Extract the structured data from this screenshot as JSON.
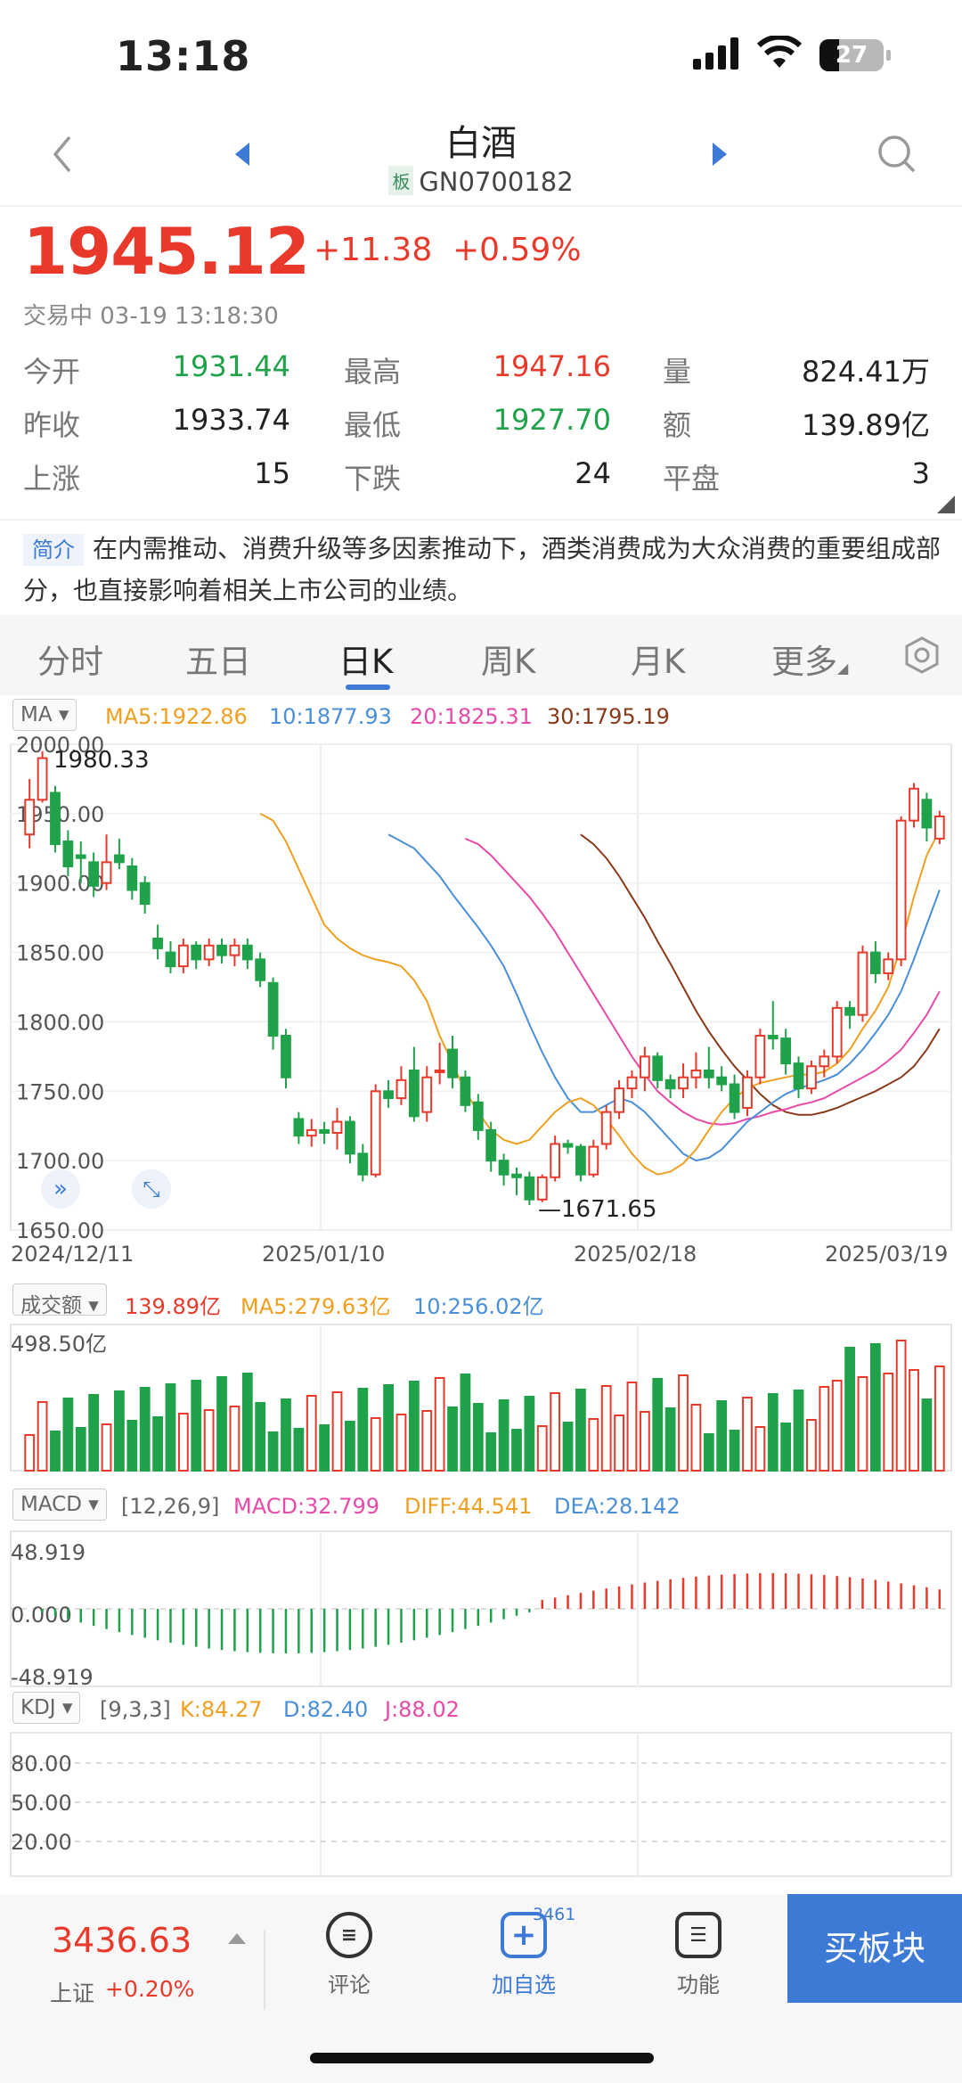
{
  "status_bar": {
    "time": "13:18",
    "battery": "27"
  },
  "header": {
    "title": "白酒",
    "board_tag": "板",
    "code": "GN0700182"
  },
  "quote": {
    "price": "1945.12",
    "change": "+11.38",
    "change_pct": "+0.59%",
    "status_time": "交易中 03-19 13:18:30"
  },
  "stats": [
    {
      "label": "今开",
      "value": "1931.44",
      "color": "green"
    },
    {
      "label": "最高",
      "value": "1947.16",
      "color": "red"
    },
    {
      "label": "量",
      "value": "824.41万",
      "color": "dark"
    },
    {
      "label": "昨收",
      "value": "1933.74",
      "color": "dark"
    },
    {
      "label": "最低",
      "value": "1927.70",
      "color": "green"
    },
    {
      "label": "额",
      "value": "139.89亿",
      "color": "dark"
    },
    {
      "label": "上涨",
      "value": "15",
      "color": "dark"
    },
    {
      "label": "下跌",
      "value": "24",
      "color": "dark"
    },
    {
      "label": "平盘",
      "value": "3",
      "color": "dark"
    }
  ],
  "intro": {
    "tag": "简介",
    "text": "在内需推动、消费升级等多因素推动下，酒类消费成为大众消费的重要组成部分，也直接影响着相关上市公司的业绩。"
  },
  "tabs": [
    "分时",
    "五日",
    "日K",
    "周K",
    "月K",
    "更多"
  ],
  "active_tab": "日K",
  "colors": {
    "up": "#e8392b",
    "down": "#1fa24a",
    "ma5": "#f0a020",
    "ma10": "#4a8fd8",
    "ma20": "#e84aa8",
    "ma30": "#8a3a1a",
    "accent": "#3c7ad6"
  },
  "ma_legend": {
    "selector": "MA",
    "ma5": "MA5:1922.86",
    "ma10": "10:1877.93",
    "ma20": "20:1825.31",
    "ma30": "30:1795.19"
  },
  "vol_legend": {
    "selector": "成交额",
    "value": "139.89亿",
    "ma5": "MA5:279.63亿",
    "ma10": "10:256.02亿"
  },
  "macd_legend": {
    "selector": "MACD",
    "params": "[12,26,9]",
    "macd": "MACD:32.799",
    "diff": "DIFF:44.541",
    "dea": "DEA:28.142"
  },
  "kdj_legend": {
    "selector": "KDJ",
    "params": "[9,3,3]",
    "k": "K:84.27",
    "d": "D:82.40",
    "j": "J:88.02"
  },
  "chart_data": {
    "type": "candlestick",
    "price_axis": {
      "ticks": [
        "2000.00",
        "1950.00",
        "1900.00",
        "1850.00",
        "1800.00",
        "1750.00",
        "1700.00",
        "1650.00"
      ],
      "ylim": [
        1650,
        2000
      ]
    },
    "dates": [
      "2024/12/11",
      "2025/01/10",
      "2025/02/18",
      "2025/03/19"
    ],
    "max_label": "1980.33",
    "min_label": "1671.65",
    "candles": [
      [
        1935,
        1960,
        1925,
        1975
      ],
      [
        1960,
        1990,
        1958,
        1995
      ],
      [
        1965,
        1928,
        1922,
        1970
      ],
      [
        1930,
        1912,
        1905,
        1938
      ],
      [
        1920,
        1918,
        1900,
        1930
      ],
      [
        1915,
        1898,
        1890,
        1922
      ],
      [
        1900,
        1915,
        1895,
        1935
      ],
      [
        1920,
        1915,
        1910,
        1932
      ],
      [
        1912,
        1895,
        1888,
        1918
      ],
      [
        1900,
        1885,
        1878,
        1905
      ],
      [
        1860,
        1853,
        1845,
        1870
      ],
      [
        1850,
        1840,
        1835,
        1858
      ],
      [
        1840,
        1855,
        1835,
        1860
      ],
      [
        1855,
        1845,
        1838,
        1858
      ],
      [
        1845,
        1855,
        1840,
        1860
      ],
      [
        1855,
        1848,
        1842,
        1860
      ],
      [
        1848,
        1855,
        1840,
        1860
      ],
      [
        1855,
        1845,
        1838,
        1860
      ],
      [
        1845,
        1830,
        1825,
        1850
      ],
      [
        1828,
        1790,
        1780,
        1832
      ],
      [
        1790,
        1760,
        1752,
        1795
      ],
      [
        1730,
        1718,
        1712,
        1735
      ],
      [
        1718,
        1722,
        1710,
        1730
      ],
      [
        1722,
        1720,
        1712,
        1728
      ],
      [
        1720,
        1728,
        1708,
        1738
      ],
      [
        1728,
        1705,
        1698,
        1732
      ],
      [
        1705,
        1690,
        1685,
        1712
      ],
      [
        1690,
        1750,
        1688,
        1755
      ],
      [
        1750,
        1745,
        1738,
        1758
      ],
      [
        1745,
        1758,
        1740,
        1768
      ],
      [
        1765,
        1732,
        1728,
        1782
      ],
      [
        1735,
        1760,
        1728,
        1768
      ],
      [
        1765,
        1765,
        1755,
        1785
      ],
      [
        1780,
        1760,
        1752,
        1790
      ],
      [
        1760,
        1740,
        1735,
        1765
      ],
      [
        1742,
        1722,
        1715,
        1748
      ],
      [
        1722,
        1700,
        1692,
        1728
      ],
      [
        1700,
        1690,
        1682,
        1705
      ],
      [
        1690,
        1688,
        1675,
        1695
      ],
      [
        1688,
        1672,
        1668,
        1692
      ],
      [
        1672,
        1688,
        1670,
        1690
      ],
      [
        1688,
        1712,
        1685,
        1718
      ],
      [
        1712,
        1710,
        1705,
        1715
      ],
      [
        1710,
        1690,
        1685,
        1712
      ],
      [
        1690,
        1710,
        1688,
        1715
      ],
      [
        1712,
        1735,
        1708,
        1740
      ],
      [
        1735,
        1752,
        1730,
        1758
      ],
      [
        1752,
        1760,
        1745,
        1765
      ],
      [
        1760,
        1775,
        1750,
        1782
      ],
      [
        1775,
        1758,
        1752,
        1778
      ],
      [
        1758,
        1752,
        1745,
        1762
      ],
      [
        1752,
        1760,
        1745,
        1770
      ],
      [
        1760,
        1765,
        1752,
        1778
      ],
      [
        1765,
        1760,
        1752,
        1782
      ],
      [
        1760,
        1755,
        1750,
        1768
      ],
      [
        1755,
        1735,
        1730,
        1762
      ],
      [
        1738,
        1760,
        1732,
        1765
      ],
      [
        1760,
        1790,
        1755,
        1795
      ],
      [
        1790,
        1788,
        1780,
        1815
      ],
      [
        1788,
        1770,
        1762,
        1795
      ],
      [
        1770,
        1752,
        1745,
        1775
      ],
      [
        1752,
        1768,
        1748,
        1772
      ],
      [
        1768,
        1775,
        1760,
        1780
      ],
      [
        1775,
        1810,
        1770,
        1815
      ],
      [
        1810,
        1805,
        1795,
        1815
      ],
      [
        1805,
        1850,
        1800,
        1855
      ],
      [
        1850,
        1835,
        1828,
        1858
      ],
      [
        1835,
        1845,
        1830,
        1850
      ],
      [
        1845,
        1945,
        1840,
        1948
      ],
      [
        1945,
        1968,
        1940,
        1972
      ],
      [
        1960,
        1940,
        1930,
        1965
      ],
      [
        1932,
        1948,
        1928,
        1952
      ]
    ],
    "ma": {
      "ma5": [
        1950,
        1945,
        1930,
        1910,
        1890,
        1870,
        1860,
        1853,
        1848,
        1845,
        1843,
        1840,
        1830,
        1815,
        1790,
        1770,
        1750,
        1735,
        1722,
        1715,
        1712,
        1715,
        1725,
        1735,
        1742,
        1745,
        1740,
        1730,
        1718,
        1705,
        1695,
        1690,
        1692,
        1698,
        1708,
        1722,
        1735,
        1745,
        1752,
        1756,
        1758,
        1760,
        1762,
        1762,
        1764,
        1770,
        1780,
        1795,
        1808,
        1825,
        1855,
        1890,
        1920,
        1938
      ],
      "ma10": [
        1935,
        1930,
        1925,
        1915,
        1905,
        1892,
        1880,
        1868,
        1855,
        1840,
        1820,
        1798,
        1778,
        1760,
        1745,
        1735,
        1735,
        1740,
        1745,
        1742,
        1735,
        1725,
        1715,
        1705,
        1700,
        1702,
        1708,
        1718,
        1728,
        1735,
        1742,
        1748,
        1752,
        1755,
        1758,
        1762,
        1770,
        1780,
        1792,
        1805,
        1822,
        1845,
        1870,
        1895
      ],
      "ma20": [
        1932,
        1928,
        1920,
        1910,
        1900,
        1890,
        1878,
        1865,
        1850,
        1835,
        1820,
        1805,
        1790,
        1775,
        1762,
        1750,
        1742,
        1735,
        1730,
        1727,
        1726,
        1727,
        1730,
        1732,
        1735,
        1737,
        1740,
        1742,
        1745,
        1750,
        1755,
        1760,
        1765,
        1772,
        1780,
        1792,
        1805,
        1822
      ],
      "ma30": [
        1935,
        1928,
        1918,
        1905,
        1890,
        1875,
        1858,
        1842,
        1825,
        1808,
        1793,
        1780,
        1768,
        1758,
        1748,
        1740,
        1735,
        1733,
        1733,
        1735,
        1738,
        1742,
        1746,
        1750,
        1755,
        1760,
        1768,
        1780,
        1795
      ]
    },
    "volume_axis": {
      "max_label": "498.50亿"
    },
    "macd_axis": {
      "ticks": [
        "48.919",
        "0.000",
        "-48.919"
      ]
    },
    "kdj_axis": {
      "ticks": [
        "80.00",
        "50.00",
        "20.00"
      ]
    }
  },
  "bottom_bar": {
    "index_value": "3436.63",
    "index_name": "上证",
    "index_change": "+0.20%",
    "comment": "评论",
    "add_watch": "加自选",
    "watch_count": "3461",
    "functions": "功能",
    "buy": "买板块"
  }
}
